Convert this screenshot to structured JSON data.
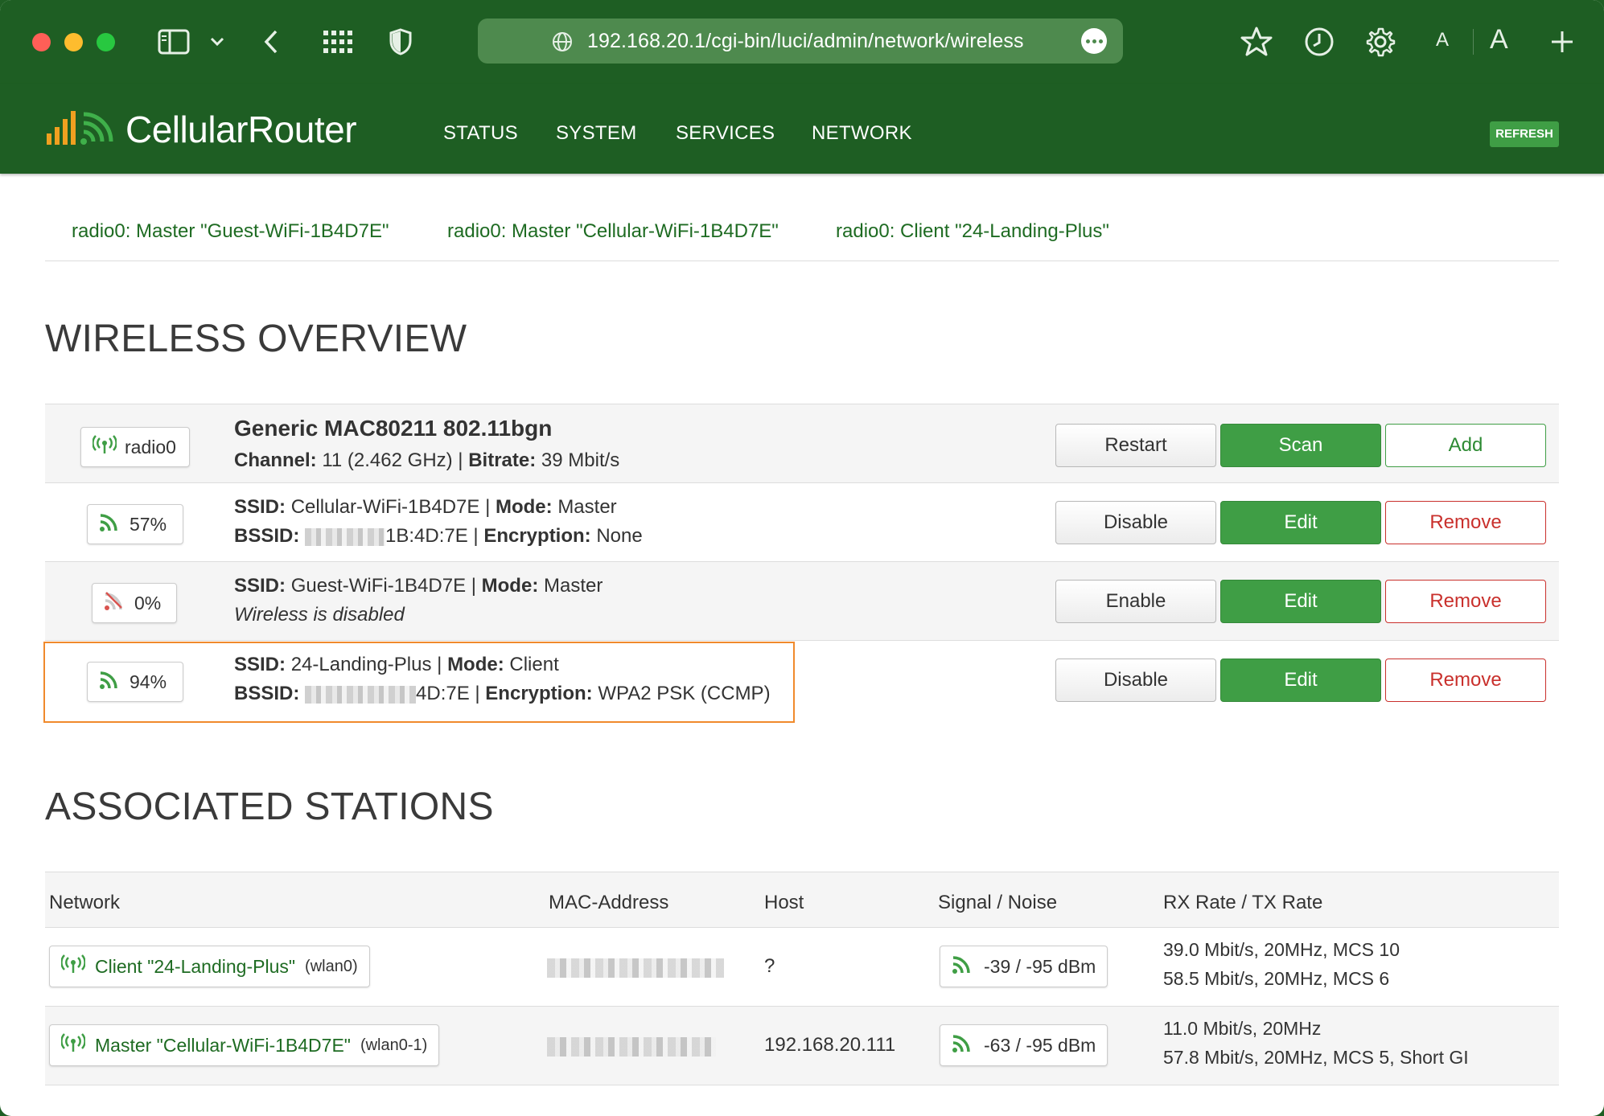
{
  "browser": {
    "url": "192.168.20.1/cgi-bin/luci/admin/network/wireless",
    "font_small_label": "A",
    "font_large_label": "A"
  },
  "header": {
    "brand": "CellularRouter",
    "nav": [
      "STATUS",
      "SYSTEM",
      "SERVICES",
      "NETWORK"
    ],
    "refresh_label": "REFRESH"
  },
  "tabs": [
    "radio0: Master \"Guest-WiFi-1B4D7E\"",
    "radio0: Master \"Cellular-WiFi-1B4D7E\"",
    "radio0: Client \"24-Landing-Plus\""
  ],
  "overview": {
    "title": "WIRELESS OVERVIEW",
    "radio": {
      "badge": "radio0",
      "name": "Generic MAC80211 802.11bgn",
      "channel_label": "Channel:",
      "channel_value": "11 (2.462 GHz)",
      "bitrate_label": "Bitrate:",
      "bitrate_value": "39 Mbit/s",
      "buttons": [
        "Restart",
        "Scan",
        "Add"
      ]
    },
    "networks": [
      {
        "signal": "57%",
        "ssid_label": "SSID:",
        "ssid": "Cellular-WiFi-1B4D7E",
        "mode_label": "Mode:",
        "mode": "Master",
        "bssid_label": "BSSID:",
        "bssid_tail": "1B:4D:7E",
        "enc_label": "Encryption:",
        "encryption": "None",
        "buttons": [
          "Disable",
          "Edit",
          "Remove"
        ]
      },
      {
        "signal": "0%",
        "ssid_label": "SSID:",
        "ssid": "Guest-WiFi-1B4D7E",
        "mode_label": "Mode:",
        "mode": "Master",
        "status": "Wireless is disabled",
        "buttons": [
          "Enable",
          "Edit",
          "Remove"
        ]
      },
      {
        "signal": "94%",
        "ssid_label": "SSID:",
        "ssid": "24-Landing-Plus",
        "mode_label": "Mode:",
        "mode": "Client",
        "bssid_label": "BSSID:",
        "bssid_tail": "4D:7E",
        "enc_label": "Encryption:",
        "encryption": "WPA2 PSK (CCMP)",
        "buttons": [
          "Disable",
          "Edit",
          "Remove"
        ]
      }
    ]
  },
  "stations": {
    "title": "ASSOCIATED STATIONS",
    "columns": [
      "Network",
      "MAC-Address",
      "Host",
      "Signal / Noise",
      "RX Rate / TX Rate"
    ],
    "rows": [
      {
        "network": "Client \"24-Landing-Plus\"",
        "iface": "(wlan0)",
        "host": "?",
        "signal_noise": "-39 / -95 dBm",
        "rx": "39.0 Mbit/s, 20MHz, MCS 10",
        "tx": "58.5 Mbit/s, 20MHz, MCS 6"
      },
      {
        "network": "Master \"Cellular-WiFi-1B4D7E\"",
        "iface": "(wlan0-1)",
        "host": "192.168.20.111",
        "signal_noise": "-63 / -95 dBm",
        "rx": "11.0 Mbit/s, 20MHz",
        "tx": "57.8 Mbit/s, 20MHz, MCS 5, Short GI"
      }
    ]
  }
}
